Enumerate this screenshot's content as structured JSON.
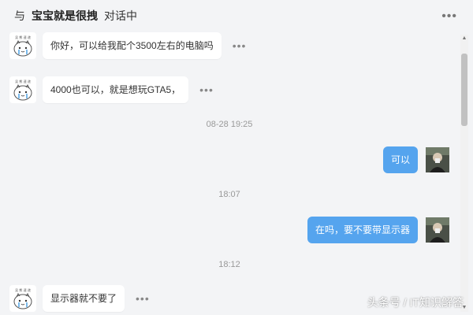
{
  "header": {
    "prefix": "与",
    "contact_name": "宝宝就是很拽",
    "status": "对话中",
    "more_icon": "more-dots-icon"
  },
  "messages": [
    {
      "side": "left",
      "text": "你好，可以给我配个3500左右的电脑吗"
    },
    {
      "side": "left",
      "text": "4000也可以，就是想玩GTA5，"
    },
    {
      "type": "time",
      "text": "08-28 19:25"
    },
    {
      "side": "right",
      "text": "可以"
    },
    {
      "type": "time",
      "text": "18:07"
    },
    {
      "side": "right",
      "text": "在吗，要不要带显示器"
    },
    {
      "type": "time",
      "text": "18:12"
    },
    {
      "side": "left",
      "text": "显示器就不要了"
    }
  ],
  "watermark": "头条号 / IT知识解答",
  "colors": {
    "background": "#f3f4f6",
    "bubble_right": "#55a4ee",
    "bubble_left": "#ffffff",
    "time_text": "#999999"
  }
}
